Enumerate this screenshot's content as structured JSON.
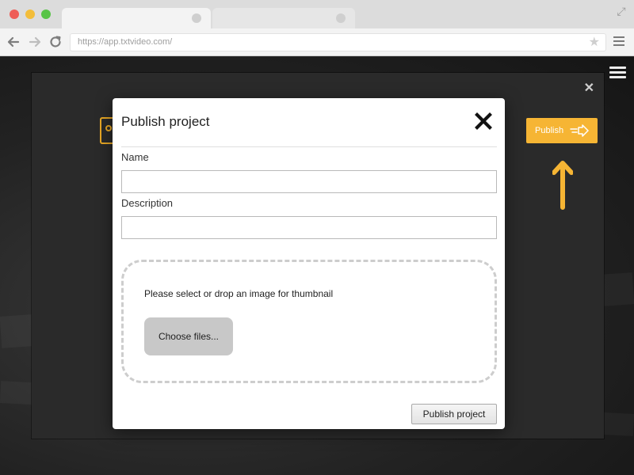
{
  "browser": {
    "url": "https://app.txtvideo.com/"
  },
  "modal": {
    "title": "Publish project",
    "name_label": "Name",
    "name_value": "",
    "description_label": "Description",
    "description_value": "",
    "dropzone_text": "Please select or drop an image for thumbnail",
    "choose_files_label": "Choose files...",
    "submit_label": "Publish project"
  },
  "toolbar": {
    "publish_label": "Publish"
  },
  "colors": {
    "accent": "#f6b534",
    "modal_bg": "#ffffff",
    "page_bg": "#1d1d1d"
  },
  "icons": {
    "close": "close-icon",
    "publish_arrow": "arrow-right-icon",
    "hint_arrow": "arrow-up-icon",
    "star": "star-icon",
    "menu": "hamburger-icon"
  }
}
